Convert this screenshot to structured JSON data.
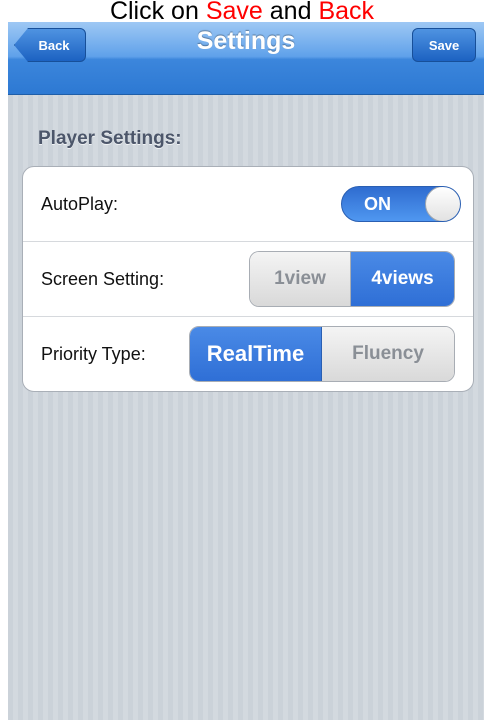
{
  "caption": {
    "text_click_on": "Click on",
    "text_save": "Save",
    "text_and": "and",
    "text_back": "Back"
  },
  "navbar": {
    "title": "Settings",
    "back_label": "Back",
    "save_label": "Save"
  },
  "section": {
    "title": "Player Settings:"
  },
  "settings": {
    "autoplay": {
      "label": "AutoPlay:",
      "toggle_text": "ON",
      "value": true
    },
    "screen_setting": {
      "label": "Screen Setting:",
      "options": [
        "1view",
        "4views"
      ],
      "selected": "4views"
    },
    "priority_type": {
      "label": "Priority Type:",
      "options": [
        "RealTime",
        "Fluency"
      ],
      "selected": "RealTime"
    }
  },
  "colors": {
    "accent": "#2f6fd6",
    "caption_highlight": "#ff0000"
  }
}
